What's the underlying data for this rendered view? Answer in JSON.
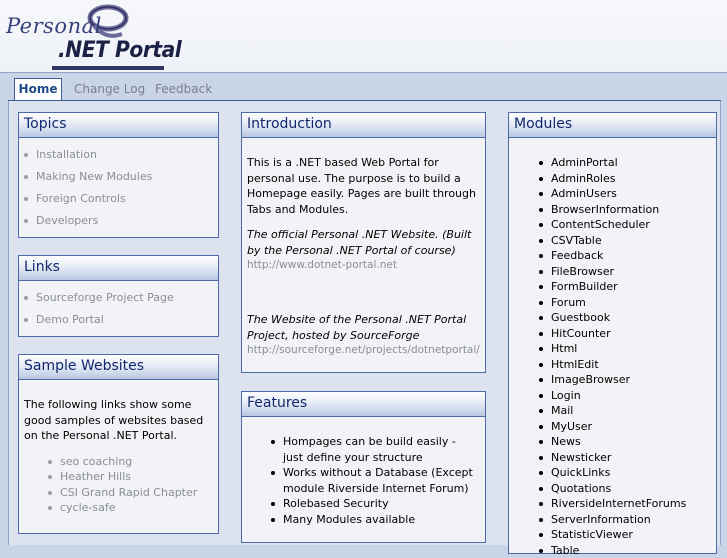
{
  "logo": {
    "personal": "Personal",
    "portal": ".NET Portal"
  },
  "tabs": [
    "Home",
    "Change Log",
    "Feedback"
  ],
  "topics": {
    "title": "Topics",
    "items": [
      "Installation",
      "Making New Modules",
      "Foreign Controls",
      "Developers"
    ]
  },
  "links": {
    "title": "Links",
    "items": [
      "Sourceforge Project Page",
      "Demo Portal"
    ]
  },
  "samples": {
    "title": "Sample Websites",
    "text": "The following links show some good samples of websites based on the Personal .NET Portal.",
    "items": [
      "seo coaching",
      "Heather Hills",
      "CSI Grand Rapid Chapter",
      "cycle-safe"
    ]
  },
  "intro": {
    "title": "Introduction",
    "text": "This is a .NET based Web Portal for personal use. The purpose is to build a Homepage easily. Pages are built through Tabs and Modules.",
    "official": "The official Personal .NET Website. (Built by the Personal .NET Portal of course)",
    "official_url": "http://www.dotnet-portal.net",
    "sf": "The Website of the Personal .NET Portal Project, hosted by SourceForge",
    "sf_url": "http://sourceforge.net/projects/dotnetportal/"
  },
  "features": {
    "title": "Features",
    "items": [
      "Hompages can be build easily - just define your structure",
      "Works without a Database (Except module Riverside Internet Forum)",
      "Rolebased Security",
      "Many Modules available"
    ]
  },
  "modules": {
    "title": "Modules",
    "items": [
      "AdminPortal",
      "AdminRoles",
      "AdminUsers",
      "BrowserInformation",
      "ContentScheduler",
      "CSVTable",
      "Feedback",
      "FileBrowser",
      "FormBuilder",
      "Forum",
      "Guestbook",
      "HitCounter",
      "Html",
      "HtmlEdit",
      "ImageBrowser",
      "Login",
      "Mail",
      "MyUser",
      "News",
      "Newsticker",
      "QuickLinks",
      "Quotations",
      "RiversideInternetForums",
      "ServerInformation",
      "StatisticViewer",
      "Table"
    ]
  }
}
